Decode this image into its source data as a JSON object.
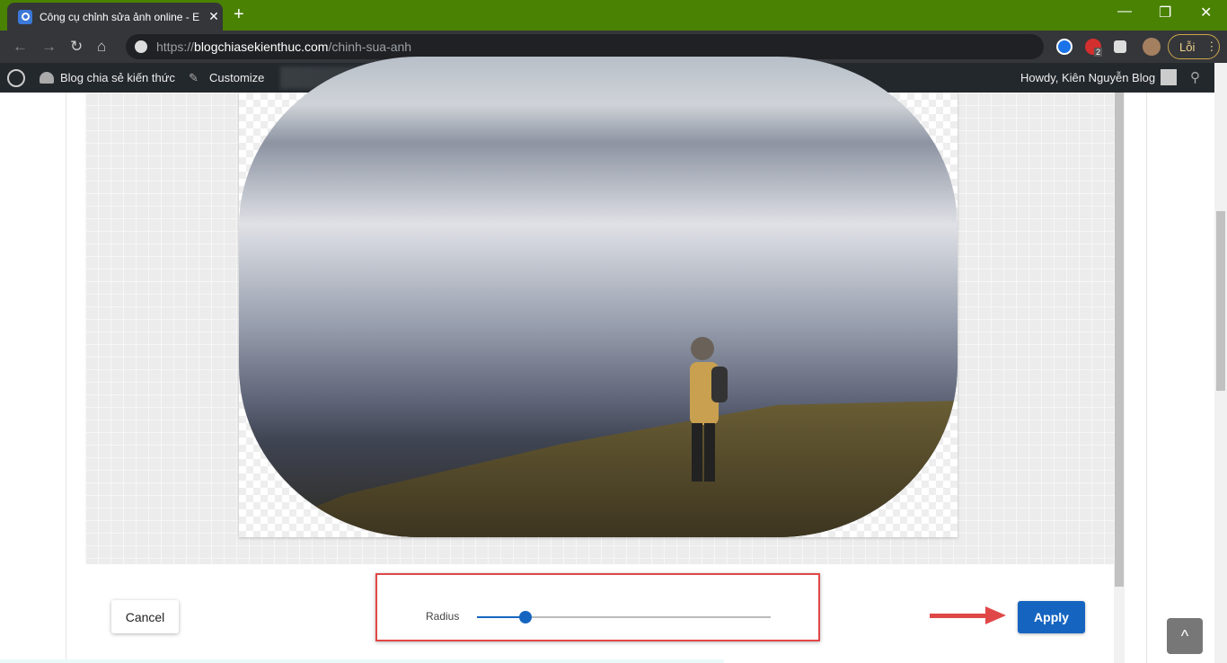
{
  "browser": {
    "tab_title": "Công cụ chỉnh sửa ảnh online - E",
    "tab_close": "✕",
    "new_tab": "+",
    "url_prefix": "https://",
    "url_domain": "blogchiasekienthuc.com",
    "url_path": "/chinh-sua-anh",
    "extension_badge": "2",
    "profile_label": "Lỗi",
    "accent": "#4a8203"
  },
  "wp_admin_bar": {
    "site_name": "Blog chia sẻ kiến thức",
    "customize": "Customize",
    "howdy": "Howdy, Kiên Nguyễn Blog"
  },
  "editor": {
    "cancel_label": "Cancel",
    "radius_label": "Radius",
    "radius_value_percent": 16.5,
    "apply_label": "Apply",
    "accent": "#1565c0",
    "highlight_color": "#e04848"
  },
  "back_to_top": "^"
}
